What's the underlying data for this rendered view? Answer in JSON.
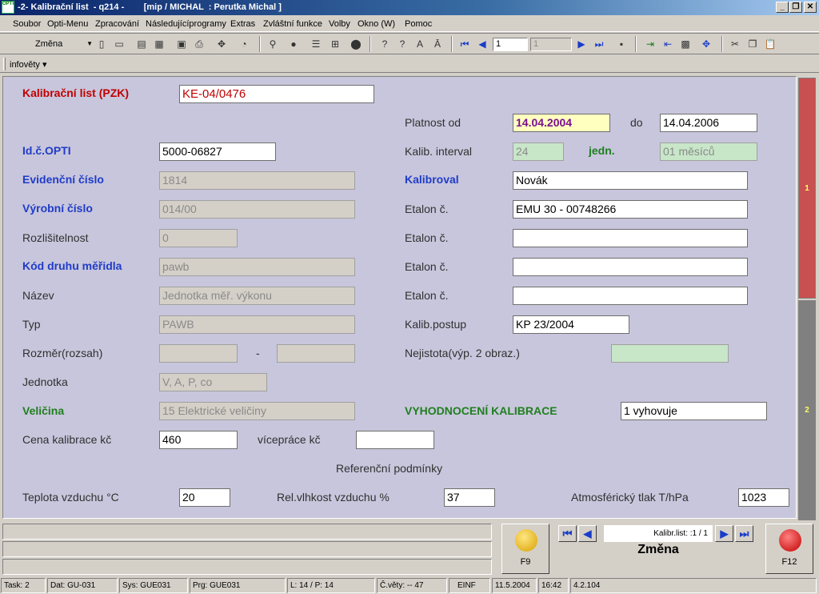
{
  "window": {
    "title": "-2- Kalibrační list  - q214 -        [mip / MICHAL  : Perutka Michal ]",
    "icon_text": "OPTI",
    "buttons": [
      "_",
      "❐",
      "✕"
    ]
  },
  "menu": [
    "Soubor",
    "Opti-Menu",
    "Zpracování",
    "Následujícíprogramy",
    "Extras",
    "Zvláštní funkce",
    "Volby",
    "Okno (W)",
    "Pomoc"
  ],
  "toolbar": {
    "mode_combo": "Změna",
    "record_number": "1",
    "record_number2": "1"
  },
  "infobar": {
    "label": "infověty ▾"
  },
  "form": {
    "header_label": "Kalibrační list (PZK)",
    "header_value": "KE-04/0476",
    "platnost_od_label": "Platnost od",
    "platnost_od": "14.04.2004",
    "do_label": "do",
    "platnost_do": "14.04.2006",
    "id_opti_label": "Id.č.OPTI",
    "id_opti": "5000-06827",
    "kalib_interval_label": "Kalib. interval",
    "kalib_interval": "24",
    "jedn_label": "jedn.",
    "jedn": "01  měsíců",
    "evidencni_label": "Evidenční číslo",
    "evidencni": "1814",
    "kalibroval_label": "Kalibroval",
    "kalibroval": "Novák",
    "vyrobni_label": "Výrobní číslo",
    "vyrobni": "014/00",
    "etalon_label": "Etalon č.",
    "etalon1": "EMU 30 - 00748266",
    "etalon2": "",
    "etalon3": "",
    "etalon4": "",
    "rozlisitelnost_label": "Rozlišitelnost",
    "rozlisitelnost": "0",
    "kod_label": "Kód druhu měřidla",
    "kod": "pawb",
    "nazev_label": "Název",
    "nazev": "Jednotka měř. výkonu",
    "typ_label": "Typ",
    "typ": "PAWB",
    "kalib_postup_label": "Kalib.postup",
    "kalib_postup": "KP 23/2004",
    "rozmer_label": "Rozměr(rozsah)",
    "rozmer_od": "",
    "rozmer_sep": "-",
    "rozmer_do": "",
    "nejistota_label": "Nejistota(výp. 2 obraz.)",
    "nejistota": "",
    "jednotka_label": "Jednotka",
    "jednotka": "V, A, P, co",
    "velicina_label": "Veličina",
    "velicina": "15  Elektrické veličiny",
    "vyhodnoceni_label": "VYHODNOCENÍ KALIBRACE",
    "vyhodnoceni": "1   vyhovuje",
    "cena_label": "Cena kalibrace kč",
    "cena": "460",
    "viceprace_label": "vícepráce kč",
    "viceprace": "",
    "ref_label": "Referenční podmínky",
    "teplota_label": "Teplota vzduchu °C",
    "teplota": "20",
    "vlhkost_label": "Rel.vlhkost vzduchu %",
    "vlhkost": "37",
    "tlak_label": "Atmosférický tlak T/hPa",
    "tlak": "1023"
  },
  "side_tabs": [
    "1",
    "2"
  ],
  "bottom": {
    "f9_label": "F9",
    "f12_label": "F12",
    "record_info": "Kalibr.list:  :1 / 1",
    "mode": "Změna"
  },
  "status": [
    "Task: 2",
    "Dat: GU-031",
    "Sys: GUE031",
    "Prg: GUE031",
    "L: 14 / P: 14",
    "Č.věty: -- 47",
    "EINF",
    "11.5.2004",
    "16:42",
    "4.2.104"
  ],
  "colors": {
    "form_bg": "#c8c6dc",
    "tab1": "#c85050",
    "tab2": "#808080",
    "accent_blue": "#1f3cc8",
    "accent_red": "#c00000",
    "accent_green": "#1f7f1f"
  }
}
